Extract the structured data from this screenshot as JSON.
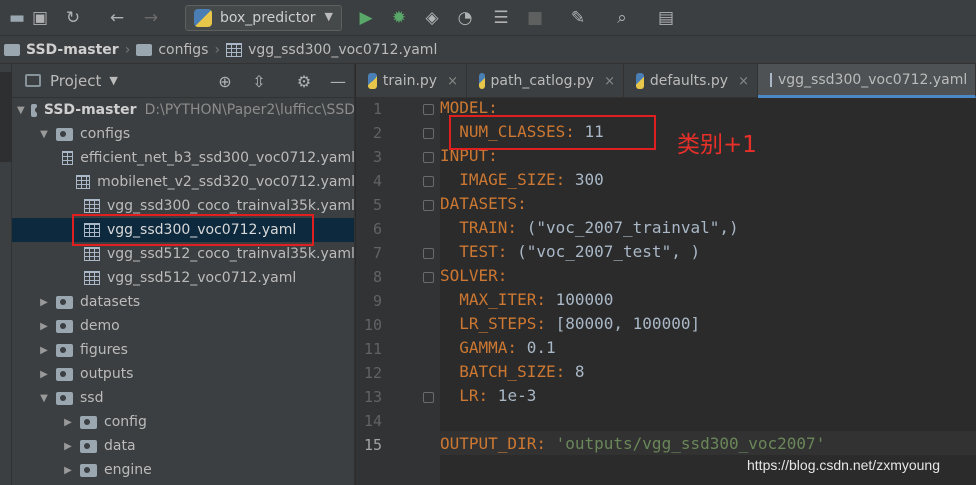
{
  "toolbar": {
    "run_config": "box_predictor",
    "icons": [
      "folder-icon",
      "save-icon",
      "sync-icon",
      "back-icon",
      "forward-icon",
      "run-icon",
      "debug-icon",
      "coverage-icon",
      "profile-icon",
      "concurrency-icon",
      "stop-icon",
      "settings-wrench-icon",
      "search-icon",
      "structure-icon"
    ]
  },
  "breadcrumb": {
    "project": "SSD-master",
    "folder": "configs",
    "file": "vgg_ssd300_voc0712.yaml"
  },
  "project_panel": {
    "title": "Project",
    "root": {
      "name": "SSD-master",
      "path": "D:\\PYTHON\\Paper2\\lufficc\\SSD"
    },
    "configs_folder": "configs",
    "config_files": [
      "efficient_net_b3_ssd300_voc0712.yaml",
      "mobilenet_v2_ssd320_voc0712.yaml",
      "vgg_ssd300_coco_trainval35k.yaml",
      "vgg_ssd300_voc0712.yaml",
      "vgg_ssd512_coco_trainval35k.yaml",
      "vgg_ssd512_voc0712.yaml"
    ],
    "folders": [
      "datasets",
      "demo",
      "figures",
      "outputs"
    ],
    "ssd_folder": "ssd",
    "ssd_children": [
      "config",
      "data",
      "engine"
    ]
  },
  "tabs": [
    {
      "label": "train.py"
    },
    {
      "label": "path_catlog.py"
    },
    {
      "label": "defaults.py"
    },
    {
      "label": "vgg_ssd300_voc0712.yaml"
    }
  ],
  "editor": {
    "line_numbers": [
      "1",
      "2",
      "3",
      "4",
      "5",
      "6",
      "7",
      "8",
      "9",
      "10",
      "11",
      "12",
      "13",
      "14",
      "15"
    ],
    "lines": {
      "l1_key": "MODEL:",
      "l2_key": "  NUM_CLASSES:",
      "l2_val": " 11",
      "l3_key": "INPUT:",
      "l4_key": "  IMAGE_SIZE:",
      "l4_val": " 300",
      "l5_key": "DATASETS:",
      "l6_key": "  TRAIN:",
      "l6_val": " (\"voc_2007_trainval\",)",
      "l7_key": "  TEST:",
      "l7_val": " (\"voc_2007_test\", )",
      "l8_key": "SOLVER:",
      "l9_key": "  MAX_ITER:",
      "l9_val": " 100000",
      "l10_key": "  LR_STEPS:",
      "l10_val": " [80000, 100000]",
      "l11_key": "  GAMMA:",
      "l11_val": " 0.1",
      "l12_key": "  BATCH_SIZE:",
      "l12_val": " 8",
      "l13_key": "  LR:",
      "l13_val": " 1e-3",
      "l15_key": "OUTPUT_DIR:",
      "l15_val": " 'outputs/vgg_ssd300_voc2007'"
    }
  },
  "annotation": "类别+1",
  "watermark": "https://blog.csdn.net/zxmyoung",
  "colors": {
    "keyword": "#cc7832",
    "string": "#6a8759",
    "number": "#a9b7c6",
    "highlight": "#e02020"
  }
}
